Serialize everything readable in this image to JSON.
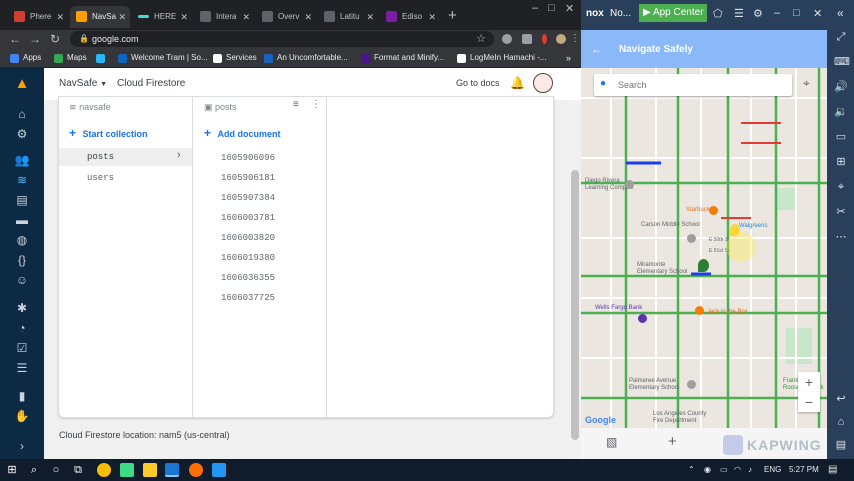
{
  "browser": {
    "tabs": [
      {
        "label": "Phere",
        "color": "#d23f31"
      },
      {
        "label": "NavSa",
        "color": "#ffa000",
        "active": true
      },
      {
        "label": "HERE",
        "color": "#48dad0"
      },
      {
        "label": "Intera",
        "color": "#5f6368"
      },
      {
        "label": "Overv",
        "color": "#5f6368"
      },
      {
        "label": "Latitu",
        "color": "#5f6368"
      },
      {
        "label": "Ediso",
        "color": "#7b1fa2"
      }
    ],
    "new_tab": "+",
    "window_controls": [
      "–",
      "□",
      "✕"
    ],
    "url": "google.com",
    "bookmarks": [
      {
        "label": "Apps",
        "color": "#4285f4"
      },
      {
        "label": "Maps",
        "color": "#34a853"
      },
      {
        "label": "Welcome Tram | So...",
        "color": "#0a66c2"
      },
      {
        "label": "Services",
        "color": "#ffffff"
      },
      {
        "label": "An Uncomfortable...",
        "color": "#1565c0"
      },
      {
        "label": "Format and Minify...",
        "color": "#4a148c"
      },
      {
        "label": "LogMeIn Hamachi -...",
        "color": "#ffffff"
      }
    ]
  },
  "firebase": {
    "project": "NavSafe",
    "product": "Cloud Firestore",
    "go_to_docs": "Go to docs",
    "root_name": "navsafe",
    "collection_name": "posts",
    "start_collection": "Start collection",
    "add_document": "Add document",
    "collections": [
      "posts",
      "users"
    ],
    "documents": [
      "1605906096",
      "1605906181",
      "1605907384",
      "1606003781",
      "1606003820",
      "1606019380",
      "1606036355",
      "1606037725"
    ],
    "location": "Cloud Firestore location: nam5 (us-central)"
  },
  "nox": {
    "title": "No...",
    "app_center": "App Center",
    "app_title": "Navigate Safely",
    "search_placeholder": "Search",
    "map_labels": [
      "Diego Rivera\nLearning Complex",
      "Starbucks",
      "Walgreens",
      "Carson Middle School",
      "E 50th St",
      "E 51st St",
      "Miramonte\nElementary School",
      "Wells Fargo Bank",
      "Jack in the Box",
      "Palmeree Avenue\nElementary School",
      "Franklin D\nRoosevelt Park",
      "Los Angeles County\nFire Department",
      "Google"
    ],
    "zoom_in": "+",
    "zoom_out": "−",
    "watermark": "KAPWING"
  },
  "taskbar": {
    "language": "ENG",
    "time": "5:27 PM"
  }
}
